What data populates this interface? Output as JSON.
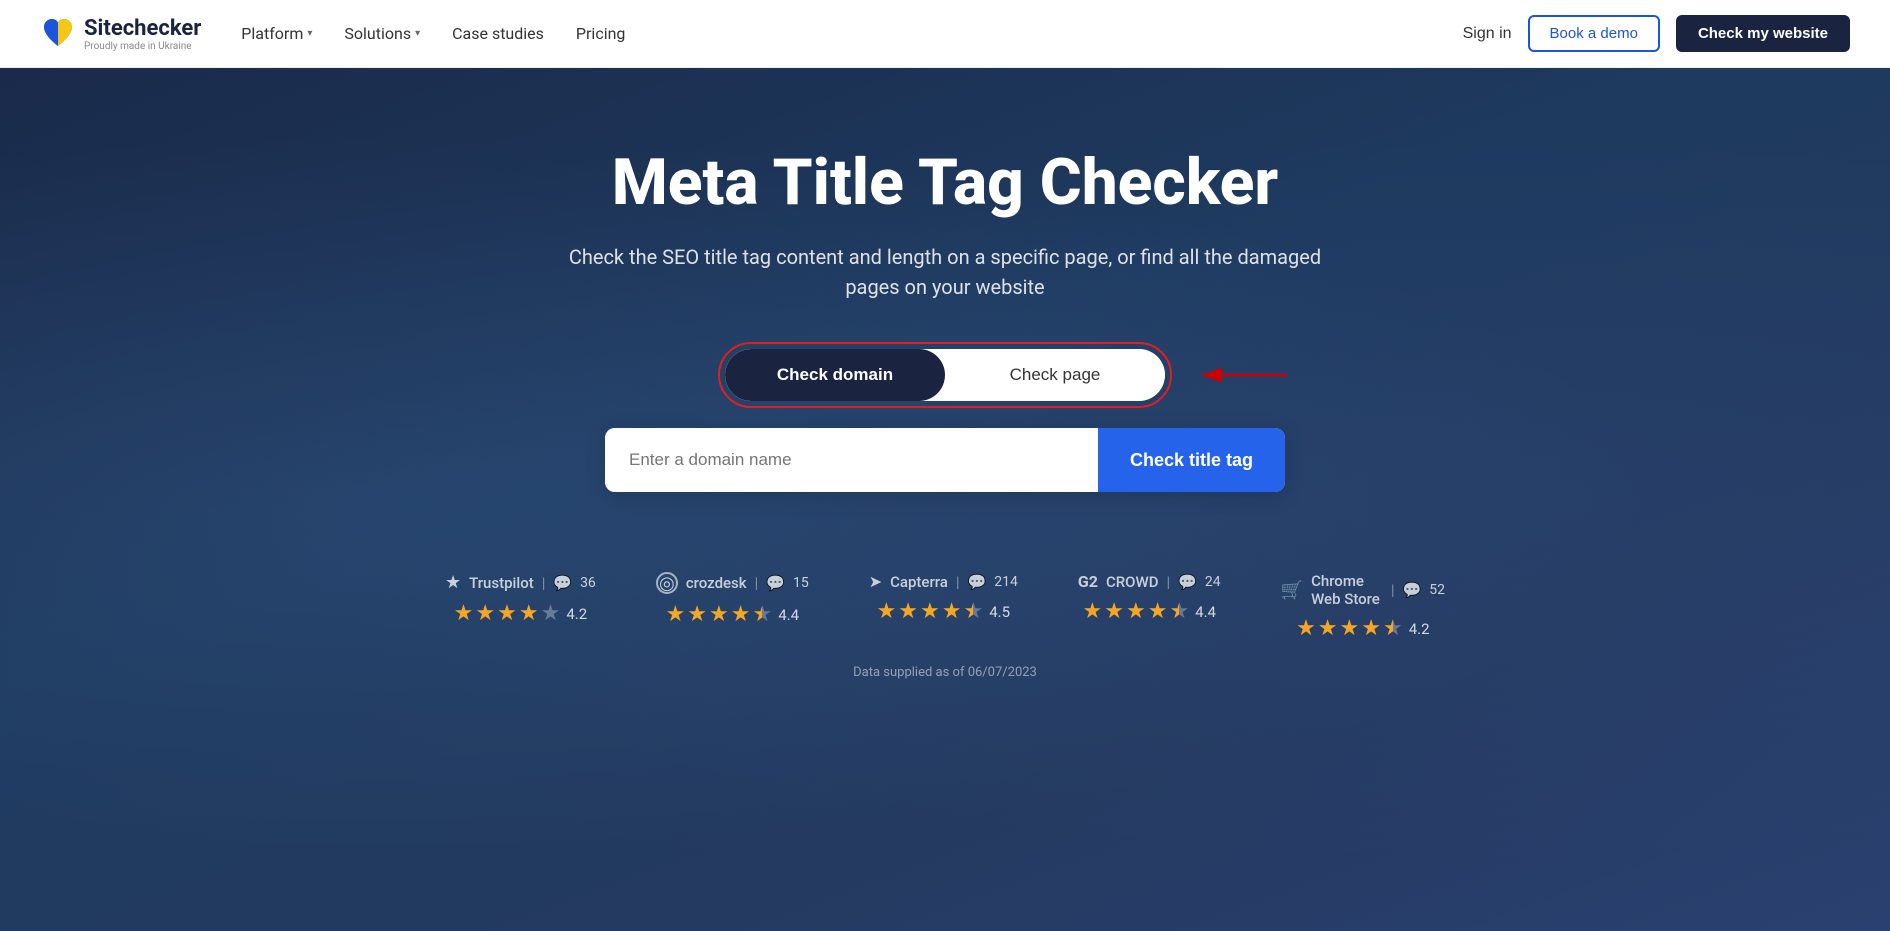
{
  "navbar": {
    "logo_title": "Sitechecker",
    "logo_sub": "Proudly made in Ukraine",
    "nav_items": [
      {
        "label": "Platform",
        "has_dropdown": true
      },
      {
        "label": "Solutions",
        "has_dropdown": true
      },
      {
        "label": "Case studies",
        "has_dropdown": false
      },
      {
        "label": "Pricing",
        "has_dropdown": false
      }
    ],
    "sign_in": "Sign in",
    "book_demo": "Book a demo",
    "check_website": "Check my website"
  },
  "hero": {
    "title": "Meta Title Tag Checker",
    "subtitle": "Check the SEO title tag content and length on a specific page, or find all the damaged pages on your website",
    "toggle": {
      "check_domain": "Check domain",
      "check_page": "Check page"
    },
    "input_placeholder": "Enter a domain name",
    "check_button": "Check title tag"
  },
  "ratings": [
    {
      "platform": "Trustpilot",
      "count": "36",
      "stars": [
        1,
        1,
        1,
        1,
        0
      ],
      "half": [
        false,
        false,
        false,
        false,
        false
      ],
      "value": "4.2"
    },
    {
      "platform": "crozdesk",
      "count": "15",
      "stars": [
        1,
        1,
        1,
        1,
        0.5
      ],
      "half": [
        false,
        false,
        false,
        false,
        true
      ],
      "value": "4.4"
    },
    {
      "platform": "Capterra",
      "count": "214",
      "stars": [
        1,
        1,
        1,
        1,
        0.5
      ],
      "half": [
        false,
        false,
        false,
        false,
        true
      ],
      "value": "4.5"
    },
    {
      "platform": "CROWD",
      "count": "24",
      "stars": [
        1,
        1,
        1,
        1,
        0.5
      ],
      "half": [
        false,
        false,
        false,
        false,
        true
      ],
      "value": "4.4"
    },
    {
      "platform": "Chrome Web Store",
      "count": "52",
      "stars": [
        1,
        1,
        1,
        1,
        0.5
      ],
      "half": [
        false,
        false,
        false,
        false,
        true
      ],
      "value": "4.2"
    }
  ],
  "data_supplied": "Data supplied as of 06/07/2023"
}
